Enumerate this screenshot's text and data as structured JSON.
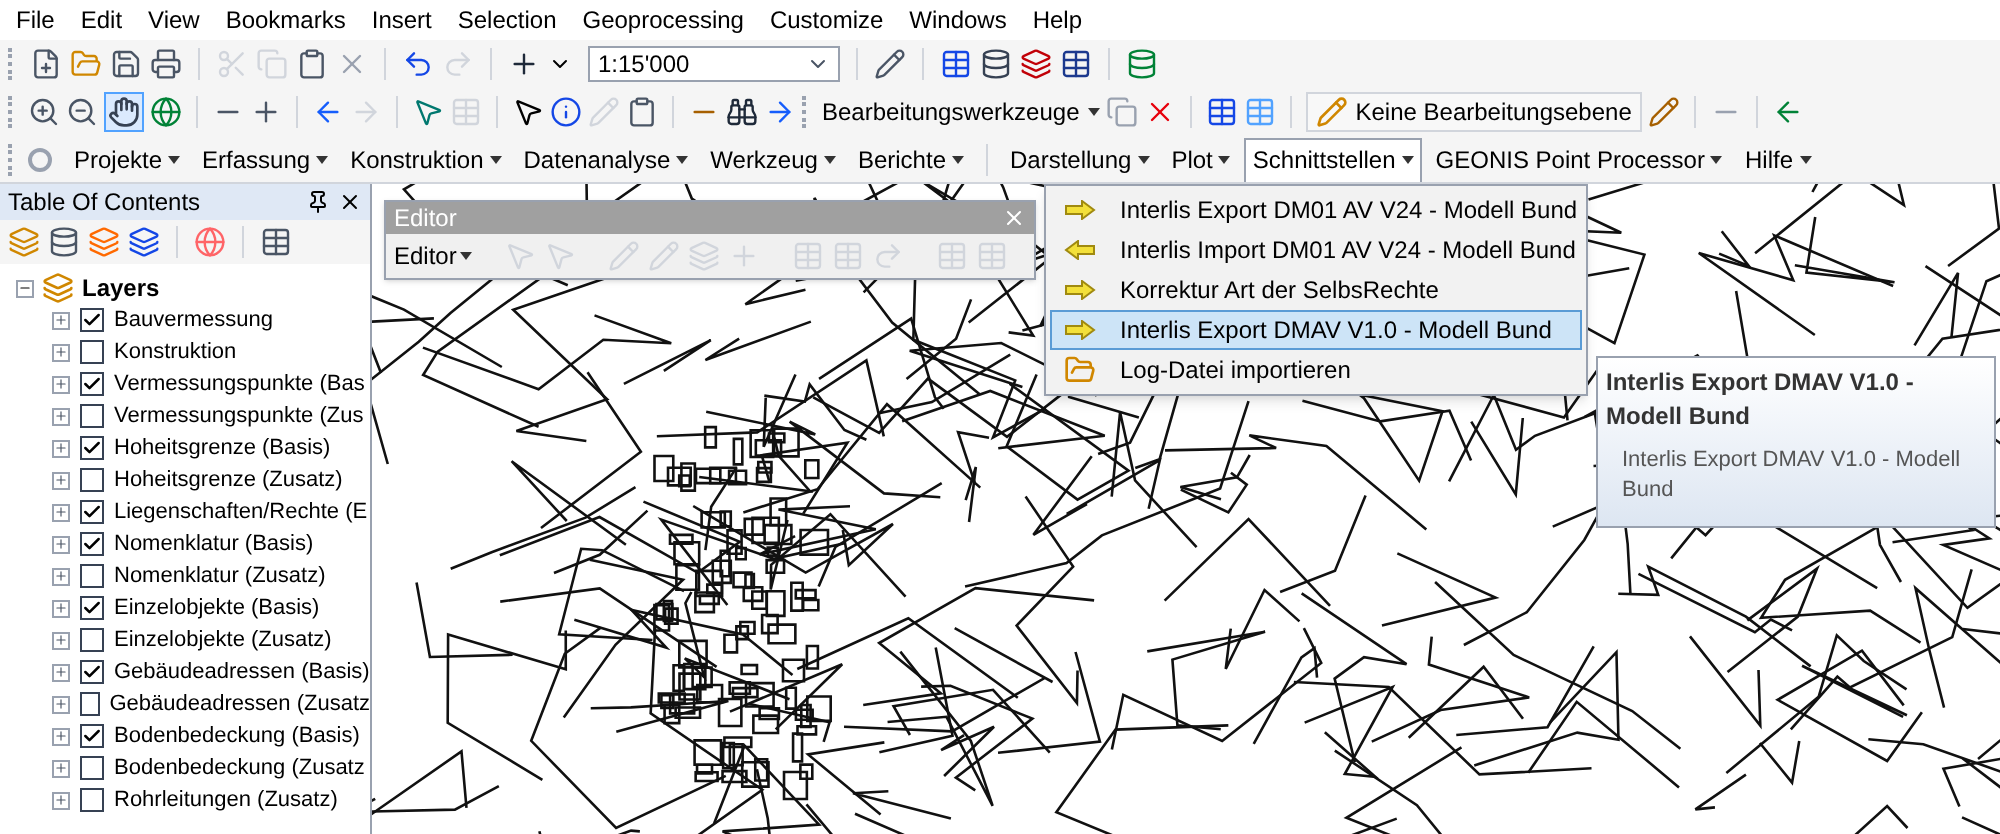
{
  "menu_bar": [
    "File",
    "Edit",
    "View",
    "Bookmarks",
    "Insert",
    "Selection",
    "Geoprocessing",
    "Customize",
    "Windows",
    "Help"
  ],
  "standard_toolbar": {
    "scale": "1:15'000"
  },
  "tools_toolbar": {
    "editor_tools": "Bearbeitungswerkzeuge",
    "edit_layer": "Keine Bearbeitungsebene"
  },
  "geonis_toolbar": [
    {
      "label": "Projekte",
      "selected": false
    },
    {
      "label": "Erfassung",
      "selected": false
    },
    {
      "label": "Konstruktion",
      "selected": false
    },
    {
      "label": "Datenanalyse",
      "selected": false
    },
    {
      "label": "Werkzeug",
      "selected": false
    },
    {
      "label": "Berichte",
      "selected": false
    },
    {
      "label": "Darstellung",
      "selected": false
    },
    {
      "label": "Plot",
      "selected": false
    },
    {
      "label": "Schnittstellen",
      "selected": true
    },
    {
      "label": "GEONIS Point Processor",
      "selected": false
    },
    {
      "label": "Hilfe",
      "selected": false
    }
  ],
  "toc": {
    "title": "Table Of Contents",
    "root": {
      "label": "Layers",
      "expanded": true,
      "children": [
        {
          "label": "Bauvermessung",
          "checked": true
        },
        {
          "label": "Konstruktion",
          "checked": false
        },
        {
          "label": "Vermessungspunkte (Bas",
          "checked": true
        },
        {
          "label": "Vermessungspunkte (Zus",
          "checked": false
        },
        {
          "label": "Hoheitsgrenze (Basis)",
          "checked": true
        },
        {
          "label": "Hoheitsgrenze (Zusatz)",
          "checked": false
        },
        {
          "label": "Liegenschaften/Rechte (E",
          "checked": true
        },
        {
          "label": "Nomenklatur (Basis)",
          "checked": true
        },
        {
          "label": "Nomenklatur (Zusatz)",
          "checked": false
        },
        {
          "label": "Einzelobjekte (Basis)",
          "checked": true
        },
        {
          "label": "Einzelobjekte (Zusatz)",
          "checked": false
        },
        {
          "label": "Gebäudeadressen (Basis)",
          "checked": true
        },
        {
          "label": "Gebäudeadressen (Zusatz",
          "checked": false
        },
        {
          "label": "Bodenbedeckung (Basis)",
          "checked": true
        },
        {
          "label": "Bodenbedeckung (Zusatz",
          "checked": false
        },
        {
          "label": "Rohrleitungen (Zusatz)",
          "checked": false
        }
      ]
    }
  },
  "editor_window": {
    "title": "Editor",
    "menu": "Editor"
  },
  "dropdown_menu": [
    {
      "label": "Interlis Export DM01 AV V24 - Modell Bund",
      "kind": "export",
      "selected": false
    },
    {
      "label": "Interlis Import DM01 AV V24 - Modell Bund",
      "kind": "import",
      "selected": false
    },
    {
      "label": "Korrektur Art der SelbsRechte",
      "kind": "export",
      "selected": false
    },
    {
      "label": "Interlis Export DMAV V1.0 - Modell Bund",
      "kind": "export",
      "selected": true
    },
    {
      "label": "Log-Datei importieren",
      "kind": "folder",
      "selected": false
    }
  ],
  "tooltip": {
    "title": "Interlis Export DMAV V1.0 - Modell Bund",
    "description": "Interlis Export DMAV V1.0 - Modell Bund"
  }
}
